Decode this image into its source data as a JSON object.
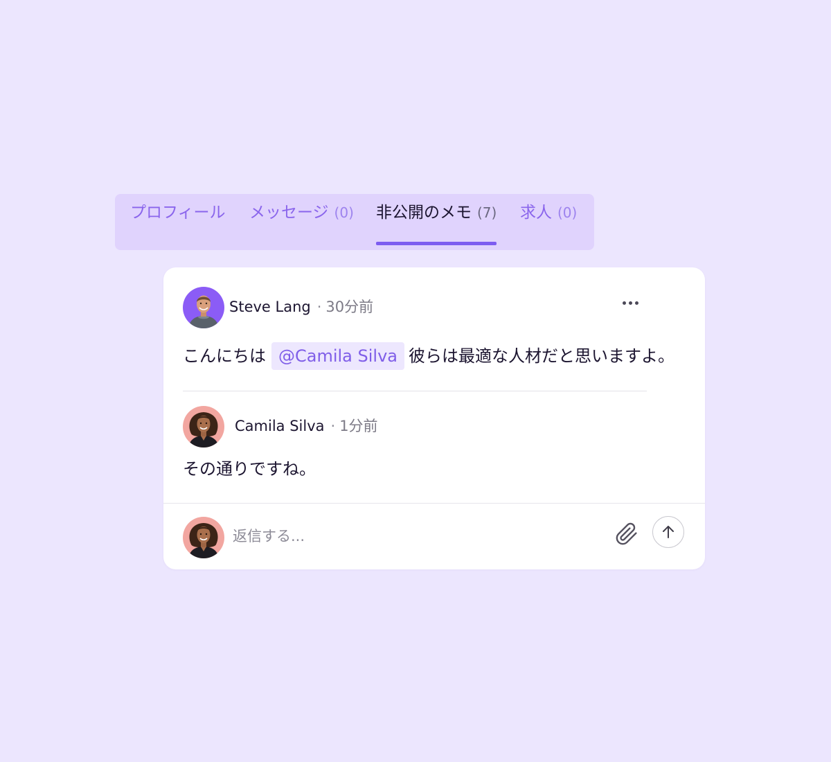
{
  "tabs": [
    {
      "label": "プロフィール",
      "count": ""
    },
    {
      "label": "メッセージ",
      "count": "(0)"
    },
    {
      "label": "非公開のメモ",
      "count": "(7)"
    },
    {
      "label": "求人",
      "count": "(0)"
    }
  ],
  "active_tab": "非公開のメモ",
  "comments": [
    {
      "author": "Steve Lang",
      "separator": "·",
      "time": "30分前",
      "text_before": "こんにちは",
      "mention": "@Camila Silva",
      "text_after": "彼らは最適な人材だと思いますよ。",
      "avatar": "avatar-steve-lang"
    },
    {
      "author": "Camila Silva",
      "separator": "·",
      "time": "1分前",
      "text": "その通りですね。",
      "avatar": "avatar-camila-silva"
    }
  ],
  "more_icon": "more-horizontal-icon",
  "composer": {
    "placeholder": "返信する...",
    "value": "",
    "attach_icon": "paperclip-icon",
    "send_icon": "arrow-up-icon"
  },
  "colors": {
    "page_background": "#ece6fe",
    "tab_bar": "#e0d3fd",
    "accent": "#7d5cf0",
    "mention_background": "#ede7fe",
    "mention_text": "#7f5ee8"
  }
}
